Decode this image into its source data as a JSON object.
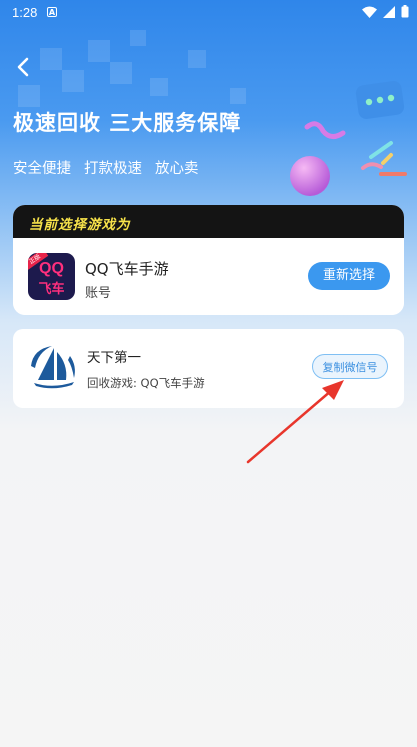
{
  "status_bar": {
    "time": "1:28",
    "notification_icon": "A"
  },
  "header": {
    "title": "极速回收 三大服务保障",
    "tags": [
      "安全便捷",
      "打款极速",
      "放心卖"
    ]
  },
  "selected_game": {
    "section_label": "当前选择游戏为",
    "game_name": "QQ飞车手游",
    "type": "账号",
    "icon_text_top": "QQ",
    "icon_text_bottom": "飞车",
    "icon_badge": "正版",
    "reselect_button": "重新选择"
  },
  "account": {
    "name": "天下第一",
    "recycle_game": "回收游戏: QQ飞车手游",
    "copy_button": "复制微信号"
  },
  "colors": {
    "primary": "#3b98ef",
    "header_band": "#141414",
    "label_yellow": "#f7e24a",
    "annotation_arrow": "#e8362c"
  }
}
